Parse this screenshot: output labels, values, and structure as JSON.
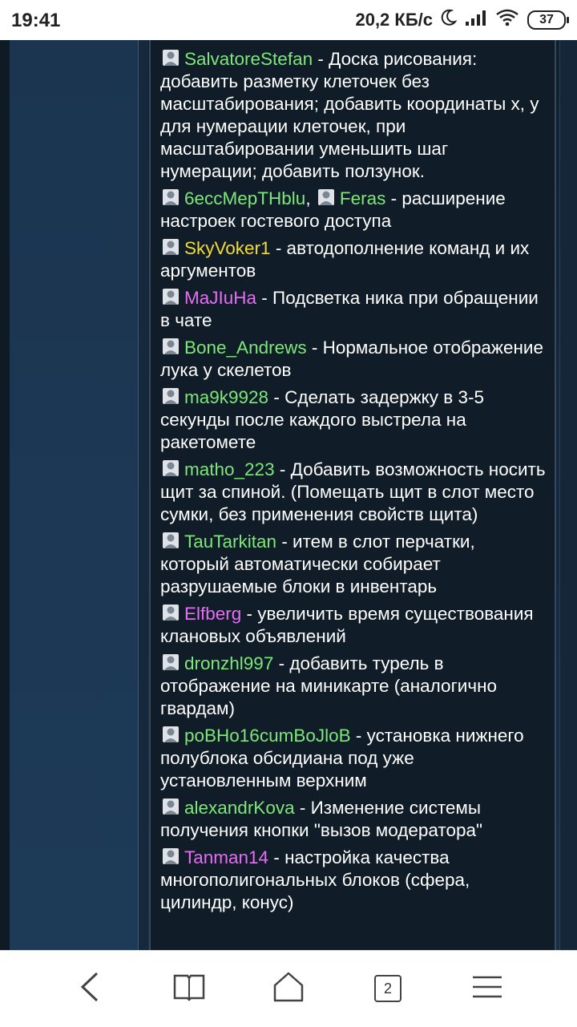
{
  "status_bar": {
    "time": "19:41",
    "speed": "20,2 КБ/с",
    "battery": "37"
  },
  "colors": {
    "green": "#7ee67a",
    "yellow": "#f3dc34",
    "pink": "#e56ef2",
    "text": "#ffffff"
  },
  "entries": [
    {
      "users": [
        {
          "nick": "SalvatoreStefan",
          "color": "#7ee67a"
        }
      ],
      "text": " - Доска рисования: добавить разметку клеточек без масштабирования; добавить координаты x, y для нумерации клеточек, при масштабировании уменьшить шаг нумерации; добавить ползунок."
    },
    {
      "users": [
        {
          "nick": "6eccMepTHblu",
          "color": "#7ee67a"
        },
        {
          "nick": "Feras",
          "color": "#7ee67a"
        }
      ],
      "text": " - расширение настроек гостевого доступа"
    },
    {
      "users": [
        {
          "nick": "SkyVoker1",
          "color": "#f3dc34"
        }
      ],
      "text": " - автодополнение команд и их аргументов"
    },
    {
      "users": [
        {
          "nick": "MaJIuHa",
          "color": "#e56ef2"
        }
      ],
      "text": " - Подсветка ника при обращении в чате"
    },
    {
      "users": [
        {
          "nick": "Bone_Andrews",
          "color": "#7ee67a"
        }
      ],
      "text": " - Нормальное отображение лука у скелетов"
    },
    {
      "users": [
        {
          "nick": "ma9k9928",
          "color": "#7ee67a"
        }
      ],
      "text": " - Сделать задержку в 3-5 секунды после каждого выстрела на ракетомете"
    },
    {
      "users": [
        {
          "nick": "matho_223",
          "color": "#7ee67a"
        }
      ],
      "text": " - Добавить возможность носить щит за спиной. (Помещать щит в слот место сумки, без применения свойств щита)"
    },
    {
      "users": [
        {
          "nick": "TauTarkitan",
          "color": "#7ee67a"
        }
      ],
      "text": " - итем в слот перчатки, который автоматически собирает разрушаемые блоки в инвентарь"
    },
    {
      "users": [
        {
          "nick": "Elfberg",
          "color": "#e56ef2"
        }
      ],
      "text": " - увеличить время существования клановых объявлений"
    },
    {
      "users": [
        {
          "nick": "dronzhl997",
          "color": "#7ee67a"
        }
      ],
      "text": " - добавить турель в отображение на миникарте (аналогично гвардам)"
    },
    {
      "users": [
        {
          "nick": "poBHo16cumBoJloB",
          "color": "#7ee67a"
        }
      ],
      "text": " - установка нижнего полублока обсидиана под уже установленным верхним"
    },
    {
      "users": [
        {
          "nick": "alexandrKova",
          "color": "#7ee67a"
        }
      ],
      "text": " - Изменение системы получения кнопки \"вызов модератора\""
    },
    {
      "users": [
        {
          "nick": "Tanman14",
          "color": "#e56ef2"
        }
      ],
      "text": " - настройка качества многополигональных блоков (сфера, цилиндр, конус)"
    }
  ],
  "bottom_nav": {
    "tab_count": "2",
    "icons": [
      "back-icon",
      "book-icon",
      "home-icon",
      "tabs-icon",
      "menu-icon"
    ]
  }
}
